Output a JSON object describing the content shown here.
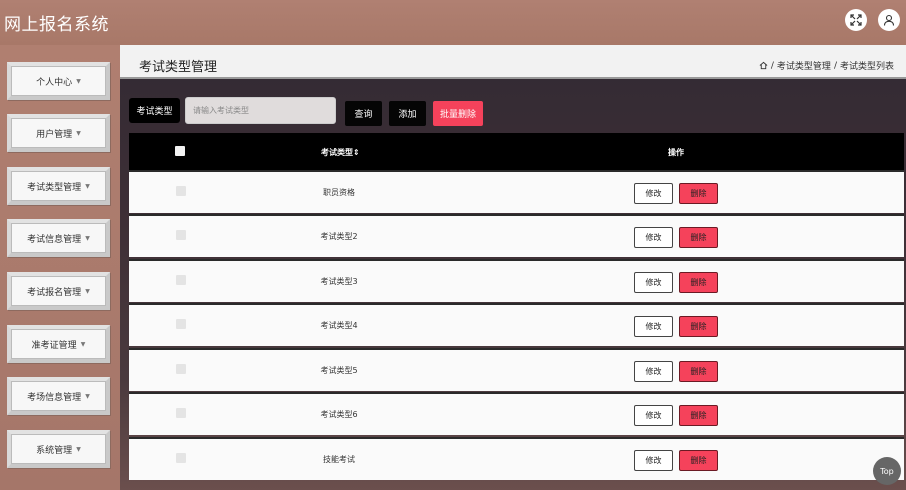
{
  "app": {
    "title": "网上报名系统"
  },
  "header": {
    "icons": [
      "fullscreen-icon",
      "user-icon"
    ]
  },
  "sidebar": {
    "items": [
      {
        "label": "个人中心"
      },
      {
        "label": "用户管理"
      },
      {
        "label": "考试类型管理"
      },
      {
        "label": "考试信息管理"
      },
      {
        "label": "考试报名管理"
      },
      {
        "label": "准考证管理"
      },
      {
        "label": "考场信息管理"
      },
      {
        "label": "系统管理"
      }
    ],
    "caret": "▼"
  },
  "page": {
    "title": "考试类型管理",
    "breadcrumb": {
      "sep": "/",
      "level1": "考试类型管理",
      "level2": "考试类型列表"
    }
  },
  "search": {
    "label": "考试类型",
    "placeholder": "请输入考试类型",
    "query_button": "查询",
    "add_button": "添加",
    "batch_delete_button": "批量删除"
  },
  "table": {
    "columns": {
      "type": "考试类型",
      "sort_icon": "⇕",
      "actions": "操作"
    },
    "rows": [
      {
        "type": "职员资格"
      },
      {
        "type": "考试类型2"
      },
      {
        "type": "考试类型3"
      },
      {
        "type": "考试类型4"
      },
      {
        "type": "考试类型5"
      },
      {
        "type": "考试类型6"
      },
      {
        "type": "技能考试"
      }
    ],
    "edit_label": "修改",
    "delete_label": "删除"
  },
  "back_to_top": "Top",
  "colors": {
    "accent_red": "#f5425b",
    "sidebar_bg": "#a97a6c",
    "header_black": "#000000"
  }
}
